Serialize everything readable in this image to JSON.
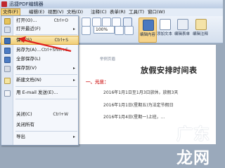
{
  "window": {
    "title": "迅捷PDF编辑器"
  },
  "menubar": [
    "文件(F)",
    "编辑(E)",
    "视图(V)",
    "文档(D)",
    "注释(C)",
    "表单(R)",
    "工具(T)",
    "窗口(W)"
  ],
  "toolbar": {
    "zoom": "100%",
    "big_buttons": [
      "编辑内容",
      "添加文本",
      "编辑表单",
      "编辑注释"
    ]
  },
  "file_menu": {
    "items": [
      {
        "label": "打开(O)...",
        "shortcut": "Ctrl+O",
        "arrow": false
      },
      {
        "label": "打开最近(F)",
        "shortcut": "",
        "arrow": true
      },
      {
        "label": "保存(S)",
        "shortcut": "Ctrl+S",
        "arrow": false
      },
      {
        "label": "另存为(A)...",
        "shortcut": "Ctrl+Shift+S",
        "arrow": false
      },
      {
        "label": "全部保存(L)",
        "shortcut": "",
        "arrow": false
      },
      {
        "label": "保存到(V)",
        "shortcut": "",
        "arrow": true
      },
      {
        "label": "新建文档(N)",
        "shortcut": "",
        "arrow": true
      },
      {
        "label": "用 E-mail 发送(E)...",
        "shortcut": "",
        "arrow": false
      },
      {
        "label": "关闭(C)",
        "shortcut": "Ctrl+W",
        "arrow": false
      },
      {
        "label": "关闭所有",
        "shortcut": "",
        "arrow": false
      },
      {
        "label": "导出",
        "shortcut": "",
        "arrow": true
      }
    ]
  },
  "document": {
    "header": "举例页眉",
    "title": "放假安排时间表",
    "section": "一、元旦：",
    "lines": [
      "2016年1月1日至1月3日放休，放假3天",
      "2016年1月1日(星期五)为法定节假日",
      "2016年1月4日(星期一)上班，..."
    ],
    "watermark": "广东龙网"
  }
}
